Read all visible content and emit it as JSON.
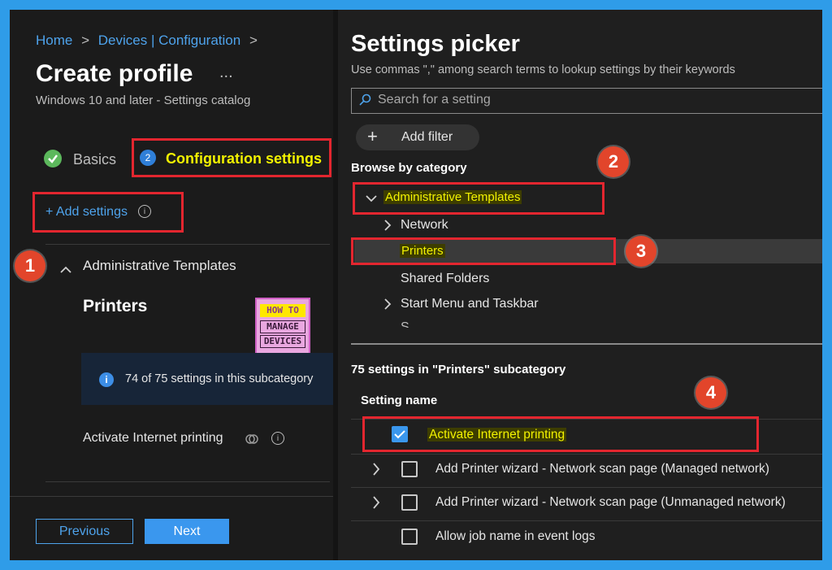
{
  "breadcrumb": {
    "home": "Home",
    "devices": "Devices | Configuration"
  },
  "profile": {
    "title": "Create profile",
    "more": "...",
    "subtitle": "Windows 10 and later - Settings catalog"
  },
  "steps": {
    "basics": "Basics",
    "config_num": "2",
    "config": "Configuration settings"
  },
  "add_settings": "+ Add settings",
  "left_section": {
    "category": "Administrative Templates",
    "subcategory": "Printers",
    "info": "74 of 75 settings in this subcategory",
    "setting": "Activate Internet printing"
  },
  "logo": {
    "line1": "HOW TO",
    "line2": "MANAGE",
    "line3": "DEVICES"
  },
  "footer": {
    "previous": "Previous",
    "next": "Next"
  },
  "picker": {
    "title": "Settings picker",
    "hint": "Use commas \",\" among search terms to lookup settings by their keywords",
    "search_placeholder": "Search for a setting",
    "add_filter": "Add filter",
    "browse_label": "Browse by category",
    "tree": {
      "admin": "Administrative Templates",
      "network": "Network",
      "printers": "Printers",
      "shared": "Shared Folders",
      "start_menu": "Start Menu and Taskbar",
      "partial": "S..."
    },
    "results_header": "75 settings in \"Printers\" subcategory",
    "column_header": "Setting name",
    "rows": [
      {
        "name": "Activate Internet printing"
      },
      {
        "name": "Add Printer wizard - Network scan page (Managed network)"
      },
      {
        "name": "Add Printer wizard - Network scan page (Unmanaged network)"
      },
      {
        "name": "Allow job name in event logs"
      }
    ]
  },
  "badges": {
    "b1": "1",
    "b2": "2",
    "b3": "3",
    "b4": "4"
  },
  "colors": {
    "accent": "#4ea3ec",
    "annotation_red": "#e3262f",
    "highlight_yellow": "#f2f200",
    "frame_blue": "#2f9ce8"
  }
}
